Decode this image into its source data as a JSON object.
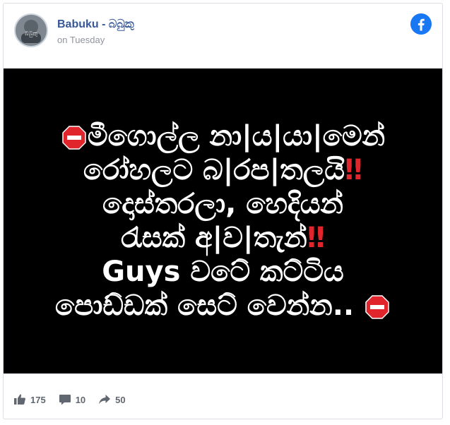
{
  "post": {
    "author": "Babuku - බබුකු",
    "timestamp": "on Tuesday",
    "avatar_text": "බබුකු",
    "image_text_lines": [
      "මීගොල්ල නා|ය|යා|මෙන්",
      "රෝහලට බ|රප|තලයි",
      "දොස්තරලා, හෙදියන්",
      "රැසක් අ|ව|තැන්",
      "Guys වටේ කට්ටිය",
      "පොඩ්ඩක් සෙට් වෙන්න.."
    ],
    "emphasis_marks": "‼"
  },
  "stats": {
    "likes": "175",
    "comments": "10",
    "shares": "50"
  },
  "icons": {
    "facebook": "facebook-logo-icon",
    "like": "thumbs-up-icon",
    "comment": "comment-icon",
    "share": "share-arrow-icon",
    "stop": "stop-sign-icon"
  },
  "colors": {
    "author": "#385898",
    "facebook_blue": "#1877f2",
    "stop_red": "#e0252d",
    "post_background": "#000000"
  }
}
